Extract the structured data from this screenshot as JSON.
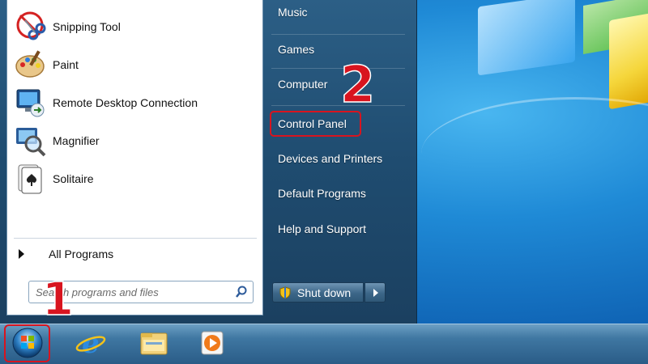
{
  "start_menu": {
    "programs": [
      {
        "label": "Snipping Tool",
        "icon": "scissors-icon"
      },
      {
        "label": "Paint",
        "icon": "palette-icon"
      },
      {
        "label": "Remote Desktop Connection",
        "icon": "remote-desktop-icon"
      },
      {
        "label": "Magnifier",
        "icon": "magnifier-icon"
      },
      {
        "label": "Solitaire",
        "icon": "playing-card-icon"
      }
    ],
    "all_programs_label": "All Programs",
    "search_placeholder": "Search programs and files",
    "right_links": [
      "Music",
      "Games",
      "Computer",
      "Control Panel",
      "Devices and Printers",
      "Default Programs",
      "Help and Support"
    ],
    "shutdown_label": "Shut down"
  },
  "taskbar": {
    "items": [
      "start-orb-icon",
      "internet-explorer-icon",
      "file-explorer-icon",
      "media-player-icon"
    ]
  },
  "annotations": {
    "step1": "1",
    "step2": "2",
    "highlight_color": "#d8141f"
  }
}
